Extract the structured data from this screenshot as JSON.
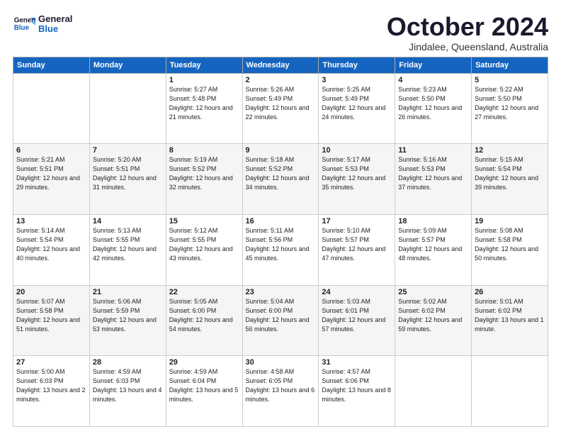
{
  "logo": {
    "line1": "General",
    "line2": "Blue"
  },
  "title": "October 2024",
  "subtitle": "Jindalee, Queensland, Australia",
  "header_days": [
    "Sunday",
    "Monday",
    "Tuesday",
    "Wednesday",
    "Thursday",
    "Friday",
    "Saturday"
  ],
  "weeks": [
    [
      {
        "day": "",
        "sunrise": "",
        "sunset": "",
        "daylight": ""
      },
      {
        "day": "",
        "sunrise": "",
        "sunset": "",
        "daylight": ""
      },
      {
        "day": "1",
        "sunrise": "Sunrise: 5:27 AM",
        "sunset": "Sunset: 5:48 PM",
        "daylight": "Daylight: 12 hours and 21 minutes."
      },
      {
        "day": "2",
        "sunrise": "Sunrise: 5:26 AM",
        "sunset": "Sunset: 5:49 PM",
        "daylight": "Daylight: 12 hours and 22 minutes."
      },
      {
        "day": "3",
        "sunrise": "Sunrise: 5:25 AM",
        "sunset": "Sunset: 5:49 PM",
        "daylight": "Daylight: 12 hours and 24 minutes."
      },
      {
        "day": "4",
        "sunrise": "Sunrise: 5:23 AM",
        "sunset": "Sunset: 5:50 PM",
        "daylight": "Daylight: 12 hours and 26 minutes."
      },
      {
        "day": "5",
        "sunrise": "Sunrise: 5:22 AM",
        "sunset": "Sunset: 5:50 PM",
        "daylight": "Daylight: 12 hours and 27 minutes."
      }
    ],
    [
      {
        "day": "6",
        "sunrise": "Sunrise: 5:21 AM",
        "sunset": "Sunset: 5:51 PM",
        "daylight": "Daylight: 12 hours and 29 minutes."
      },
      {
        "day": "7",
        "sunrise": "Sunrise: 5:20 AM",
        "sunset": "Sunset: 5:51 PM",
        "daylight": "Daylight: 12 hours and 31 minutes."
      },
      {
        "day": "8",
        "sunrise": "Sunrise: 5:19 AM",
        "sunset": "Sunset: 5:52 PM",
        "daylight": "Daylight: 12 hours and 32 minutes."
      },
      {
        "day": "9",
        "sunrise": "Sunrise: 5:18 AM",
        "sunset": "Sunset: 5:52 PM",
        "daylight": "Daylight: 12 hours and 34 minutes."
      },
      {
        "day": "10",
        "sunrise": "Sunrise: 5:17 AM",
        "sunset": "Sunset: 5:53 PM",
        "daylight": "Daylight: 12 hours and 35 minutes."
      },
      {
        "day": "11",
        "sunrise": "Sunrise: 5:16 AM",
        "sunset": "Sunset: 5:53 PM",
        "daylight": "Daylight: 12 hours and 37 minutes."
      },
      {
        "day": "12",
        "sunrise": "Sunrise: 5:15 AM",
        "sunset": "Sunset: 5:54 PM",
        "daylight": "Daylight: 12 hours and 39 minutes."
      }
    ],
    [
      {
        "day": "13",
        "sunrise": "Sunrise: 5:14 AM",
        "sunset": "Sunset: 5:54 PM",
        "daylight": "Daylight: 12 hours and 40 minutes."
      },
      {
        "day": "14",
        "sunrise": "Sunrise: 5:13 AM",
        "sunset": "Sunset: 5:55 PM",
        "daylight": "Daylight: 12 hours and 42 minutes."
      },
      {
        "day": "15",
        "sunrise": "Sunrise: 5:12 AM",
        "sunset": "Sunset: 5:55 PM",
        "daylight": "Daylight: 12 hours and 43 minutes."
      },
      {
        "day": "16",
        "sunrise": "Sunrise: 5:11 AM",
        "sunset": "Sunset: 5:56 PM",
        "daylight": "Daylight: 12 hours and 45 minutes."
      },
      {
        "day": "17",
        "sunrise": "Sunrise: 5:10 AM",
        "sunset": "Sunset: 5:57 PM",
        "daylight": "Daylight: 12 hours and 47 minutes."
      },
      {
        "day": "18",
        "sunrise": "Sunrise: 5:09 AM",
        "sunset": "Sunset: 5:57 PM",
        "daylight": "Daylight: 12 hours and 48 minutes."
      },
      {
        "day": "19",
        "sunrise": "Sunrise: 5:08 AM",
        "sunset": "Sunset: 5:58 PM",
        "daylight": "Daylight: 12 hours and 50 minutes."
      }
    ],
    [
      {
        "day": "20",
        "sunrise": "Sunrise: 5:07 AM",
        "sunset": "Sunset: 5:58 PM",
        "daylight": "Daylight: 12 hours and 51 minutes."
      },
      {
        "day": "21",
        "sunrise": "Sunrise: 5:06 AM",
        "sunset": "Sunset: 5:59 PM",
        "daylight": "Daylight: 12 hours and 53 minutes."
      },
      {
        "day": "22",
        "sunrise": "Sunrise: 5:05 AM",
        "sunset": "Sunset: 6:00 PM",
        "daylight": "Daylight: 12 hours and 54 minutes."
      },
      {
        "day": "23",
        "sunrise": "Sunrise: 5:04 AM",
        "sunset": "Sunset: 6:00 PM",
        "daylight": "Daylight: 12 hours and 56 minutes."
      },
      {
        "day": "24",
        "sunrise": "Sunrise: 5:03 AM",
        "sunset": "Sunset: 6:01 PM",
        "daylight": "Daylight: 12 hours and 57 minutes."
      },
      {
        "day": "25",
        "sunrise": "Sunrise: 5:02 AM",
        "sunset": "Sunset: 6:02 PM",
        "daylight": "Daylight: 12 hours and 59 minutes."
      },
      {
        "day": "26",
        "sunrise": "Sunrise: 5:01 AM",
        "sunset": "Sunset: 6:02 PM",
        "daylight": "Daylight: 13 hours and 1 minute."
      }
    ],
    [
      {
        "day": "27",
        "sunrise": "Sunrise: 5:00 AM",
        "sunset": "Sunset: 6:03 PM",
        "daylight": "Daylight: 13 hours and 2 minutes."
      },
      {
        "day": "28",
        "sunrise": "Sunrise: 4:59 AM",
        "sunset": "Sunset: 6:03 PM",
        "daylight": "Daylight: 13 hours and 4 minutes."
      },
      {
        "day": "29",
        "sunrise": "Sunrise: 4:59 AM",
        "sunset": "Sunset: 6:04 PM",
        "daylight": "Daylight: 13 hours and 5 minutes."
      },
      {
        "day": "30",
        "sunrise": "Sunrise: 4:58 AM",
        "sunset": "Sunset: 6:05 PM",
        "daylight": "Daylight: 13 hours and 6 minutes."
      },
      {
        "day": "31",
        "sunrise": "Sunrise: 4:57 AM",
        "sunset": "Sunset: 6:06 PM",
        "daylight": "Daylight: 13 hours and 8 minutes."
      },
      {
        "day": "",
        "sunrise": "",
        "sunset": "",
        "daylight": ""
      },
      {
        "day": "",
        "sunrise": "",
        "sunset": "",
        "daylight": ""
      }
    ]
  ]
}
